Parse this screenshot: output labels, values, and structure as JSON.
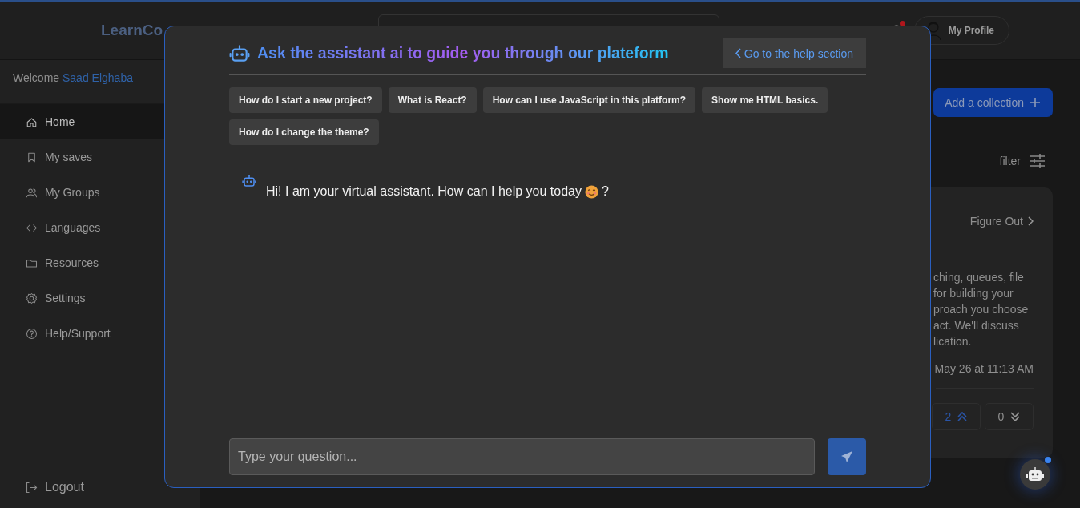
{
  "header": {
    "logo": "LearnCo",
    "notification": {
      "unread": true
    },
    "profile": "My Profile"
  },
  "sidebar": {
    "welcome": "Welcome",
    "user": "Saad Elghaba",
    "items": [
      {
        "kind": "home",
        "label": "Home",
        "selected": true
      },
      {
        "kind": "bookmark",
        "label": "My saves",
        "selected": false
      },
      {
        "kind": "users",
        "label": "My Groups",
        "selected": false
      },
      {
        "kind": "code",
        "label": "Languages",
        "selected": false
      },
      {
        "kind": "folder",
        "label": "Resources",
        "selected": false
      },
      {
        "kind": "gear",
        "label": "Settings",
        "selected": false
      },
      {
        "kind": "help",
        "label": "Help/Support",
        "selected": false
      }
    ],
    "logout": "Logout"
  },
  "main": {
    "add_button": "Add a collection",
    "filter": "filter",
    "card": {
      "link": "Figure Out",
      "lines": [
        "ching, queues, file",
        "for building your",
        "proach you choose",
        "act. We'll discuss",
        "lication."
      ],
      "date": "May 26 at 11:13 AM",
      "upvotes": "2",
      "upvoted": true,
      "downvotes": "0",
      "downvoted": false
    }
  },
  "assistant": {
    "title": "Ask the assistant ai to guide you through our plateform",
    "help_button": "Go to the help section",
    "suggestions": [
      "How do I start a new project?",
      "What is React?",
      "How can I use JavaScript in this platform?",
      "Show me HTML basics.",
      "How do I change the theme?"
    ],
    "messages": [
      {
        "kind": "bot",
        "text": "Hi! I am your virtual assistant. How can I help you today",
        "suffix": "?"
      }
    ],
    "input": {
      "placeholder": "Type your question..."
    }
  },
  "bot_fab": {
    "notification": true
  }
}
